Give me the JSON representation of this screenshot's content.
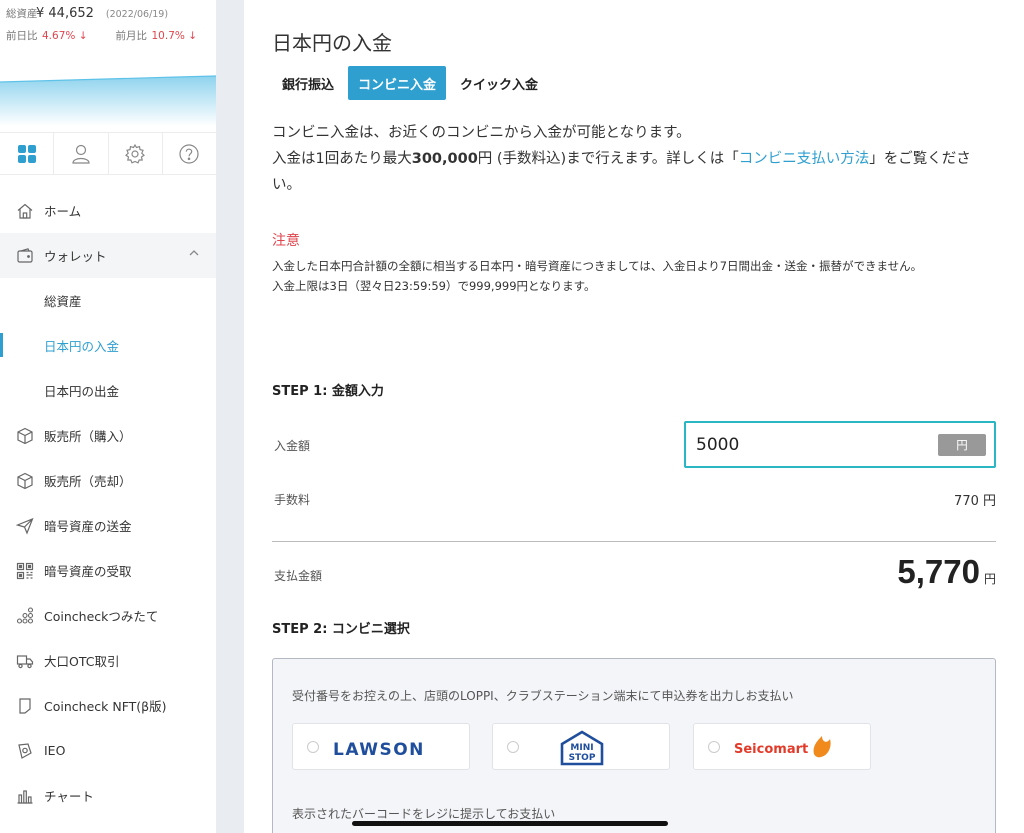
{
  "stats": {
    "total_label": "総資産",
    "total_value": "¥ 44,652",
    "date": "(2022/06/19)",
    "day_label": "前日比",
    "day_pct": "4.67% ↓",
    "month_label": "前月比",
    "month_pct": "10.7% ↓"
  },
  "icon_tabs": [
    {
      "icon": "grid-icon"
    },
    {
      "icon": "user-icon"
    },
    {
      "icon": "gear-icon"
    },
    {
      "icon": "help-icon"
    }
  ],
  "nav": {
    "home": "ホーム",
    "wallet": "ウォレット",
    "wallet_sub": [
      "総資産",
      "日本円の入金",
      "日本円の出金"
    ],
    "buy": "販売所（購入）",
    "sell": "販売所（売却）",
    "send": "暗号資産の送金",
    "receive": "暗号資産の受取",
    "tsumitate": "Coincheckつみたて",
    "otc": "大口OTC取引",
    "nft": "Coincheck NFT(β版)",
    "ieo": "IEO",
    "chart": "チャート"
  },
  "main": {
    "title": "日本円の入金",
    "tabs": [
      "銀行振込",
      "コンビニ入金",
      "クイック入金"
    ],
    "intro_1": "コンビニ入金は、お近くのコンビニから入金が可能となります。",
    "intro_2a": "入金は1回あたり最大",
    "intro_2b": "300,000",
    "intro_2c": "円 (手数料込)まで行えます。詳しくは「",
    "intro_link": "コンビニ支払い方法",
    "intro_2d": "」をご覧ください。",
    "caution_title": "注意",
    "caution_1": "入金した日本円合計額の全額に相当する日本円・暗号資産につきましては、入金日より7日間出金・送金・振替ができません。",
    "caution_2": "入金上限は3日（翌々日23:59:59）で999,999円となります。",
    "step1": "STEP 1: 金額入力",
    "amount_label": "入金額",
    "amount_value": "5000",
    "yen_unit": "円",
    "fee_label": "手数料",
    "fee_value": "770 円",
    "total_label": "支払金額",
    "total_value": "5,770",
    "total_unit": "円",
    "step2": "STEP 2: コンビニ選択",
    "panel_note": "受付番号をお控えの上、店頭のLOPPI、クラブステーション端末にて申込券を出力しお支払い",
    "stores": [
      "LAWSON",
      "MINI STOP",
      "Seicomart"
    ],
    "panel_note2": "表示されたバーコードをレジに提示してお支払い"
  },
  "colors": {
    "accent": "#2f9fd0",
    "input_border": "#2ab7c4",
    "caution": "#e0454d",
    "lawson": "#1f4e9c",
    "seicomart_red": "#e23b2a",
    "seicomart_orange": "#f08a1d"
  }
}
